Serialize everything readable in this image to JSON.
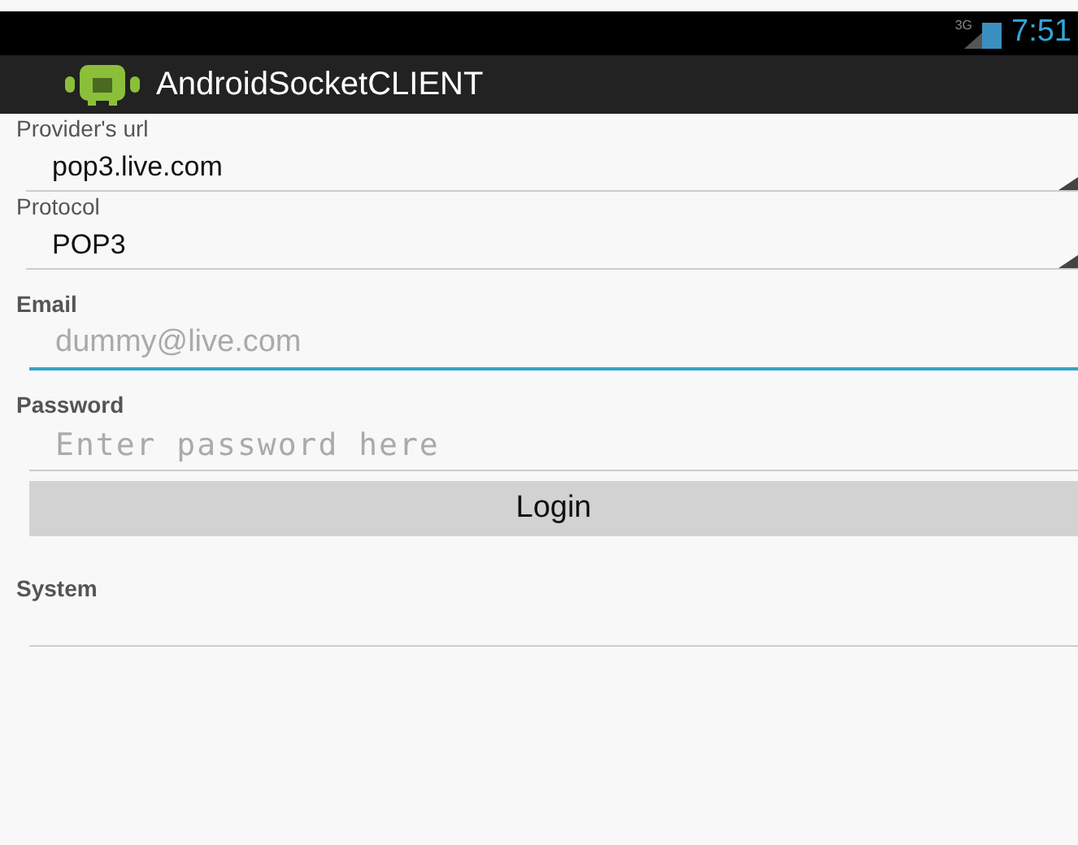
{
  "status_bar": {
    "network": "3G",
    "time": "7:51"
  },
  "app_bar": {
    "title": "AndroidSocketCLIENT"
  },
  "fields": [
    {
      "kind": "spinner",
      "label": "Provider's url",
      "value": "pop3.live.com"
    },
    {
      "kind": "spinner",
      "label": "Protocol",
      "value": "POP3"
    },
    {
      "kind": "text",
      "label": "Email",
      "placeholder": "dummy@live.com",
      "focused": true,
      "mono": false
    },
    {
      "kind": "text",
      "label": "Password",
      "placeholder": "Enter password here",
      "focused": false,
      "mono": true
    }
  ],
  "login_button": {
    "label": "Login"
  },
  "system": {
    "label": "System"
  }
}
